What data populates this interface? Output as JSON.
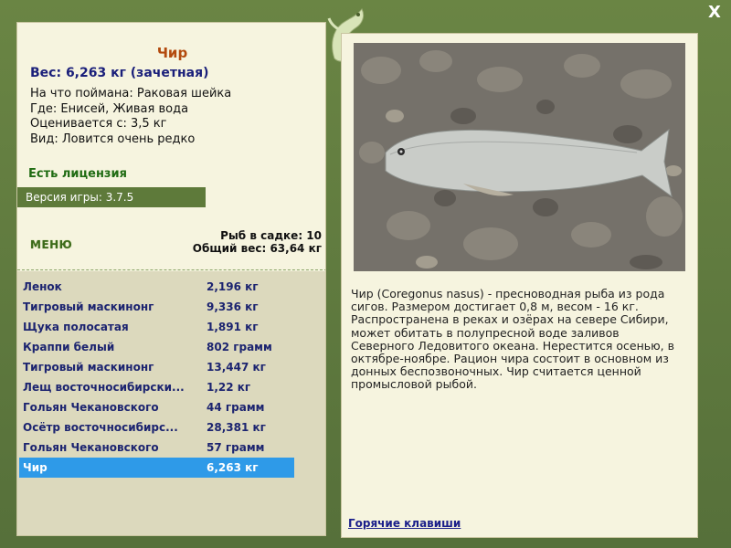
{
  "window": {
    "close_label": "X"
  },
  "fish": {
    "title": "Чир",
    "weight_line": "Вес: 6,263 кг (зачетная)",
    "bait_line": "На что поймана: Раковая шейка",
    "where_line": "Где: Енисей, Живая вода",
    "rated_line": "Оценивается с: 3,5 кг",
    "kind_line": "Вид: Ловится очень редко"
  },
  "license": "Есть лицензия",
  "version": "Версия игры: 3.7.5",
  "menu_label": "МЕНЮ",
  "cage": {
    "fish_count_line": "Рыб в садке: 10",
    "total_weight_line": "Общий вес: 63,64 кг"
  },
  "catch_list": [
    {
      "name": "Ленок",
      "weight": "2,196 кг"
    },
    {
      "name": "Тигровый маскинонг",
      "weight": "9,336 кг"
    },
    {
      "name": "Щука полосатая",
      "weight": "1,891 кг"
    },
    {
      "name": "Краппи белый",
      "weight": "802 грамм"
    },
    {
      "name": "Тигровый маскинонг",
      "weight": "13,447 кг"
    },
    {
      "name": "Лещ восточносибирски...",
      "weight": "1,22 кг"
    },
    {
      "name": "Гольян Чекановского",
      "weight": "44 грамм"
    },
    {
      "name": "Осётр восточносибирс...",
      "weight": "28,381 кг"
    },
    {
      "name": "Гольян Чекановского",
      "weight": "57 грамм"
    },
    {
      "name": "Чир",
      "weight": "6,263 кг",
      "selected": true
    }
  ],
  "description": "Чир (Coregonus nasus) - пресноводная рыба из рода сигов. Размером достигает 0,8 м, весом - 16 кг. Распространена в реках и озёрах на севере Сибири, может обитать в полупресной воде заливов Северного Ледовитого океана. Нерестится осенью, в октябре-ноябре. Рацион чира состоит в основном из донных беспозвоночных. Чир считается ценной промысловой рыбой.",
  "hotkeys_label": "Горячие клавиши",
  "colors": {
    "frame": "#5f7a3c",
    "panel": "#f6f4df",
    "selected_row": "#2e9ae8",
    "title": "#b34a0e",
    "list_text": "#1c2470"
  },
  "icons": {
    "mascot": "lizard-icon",
    "close": "close-icon"
  }
}
